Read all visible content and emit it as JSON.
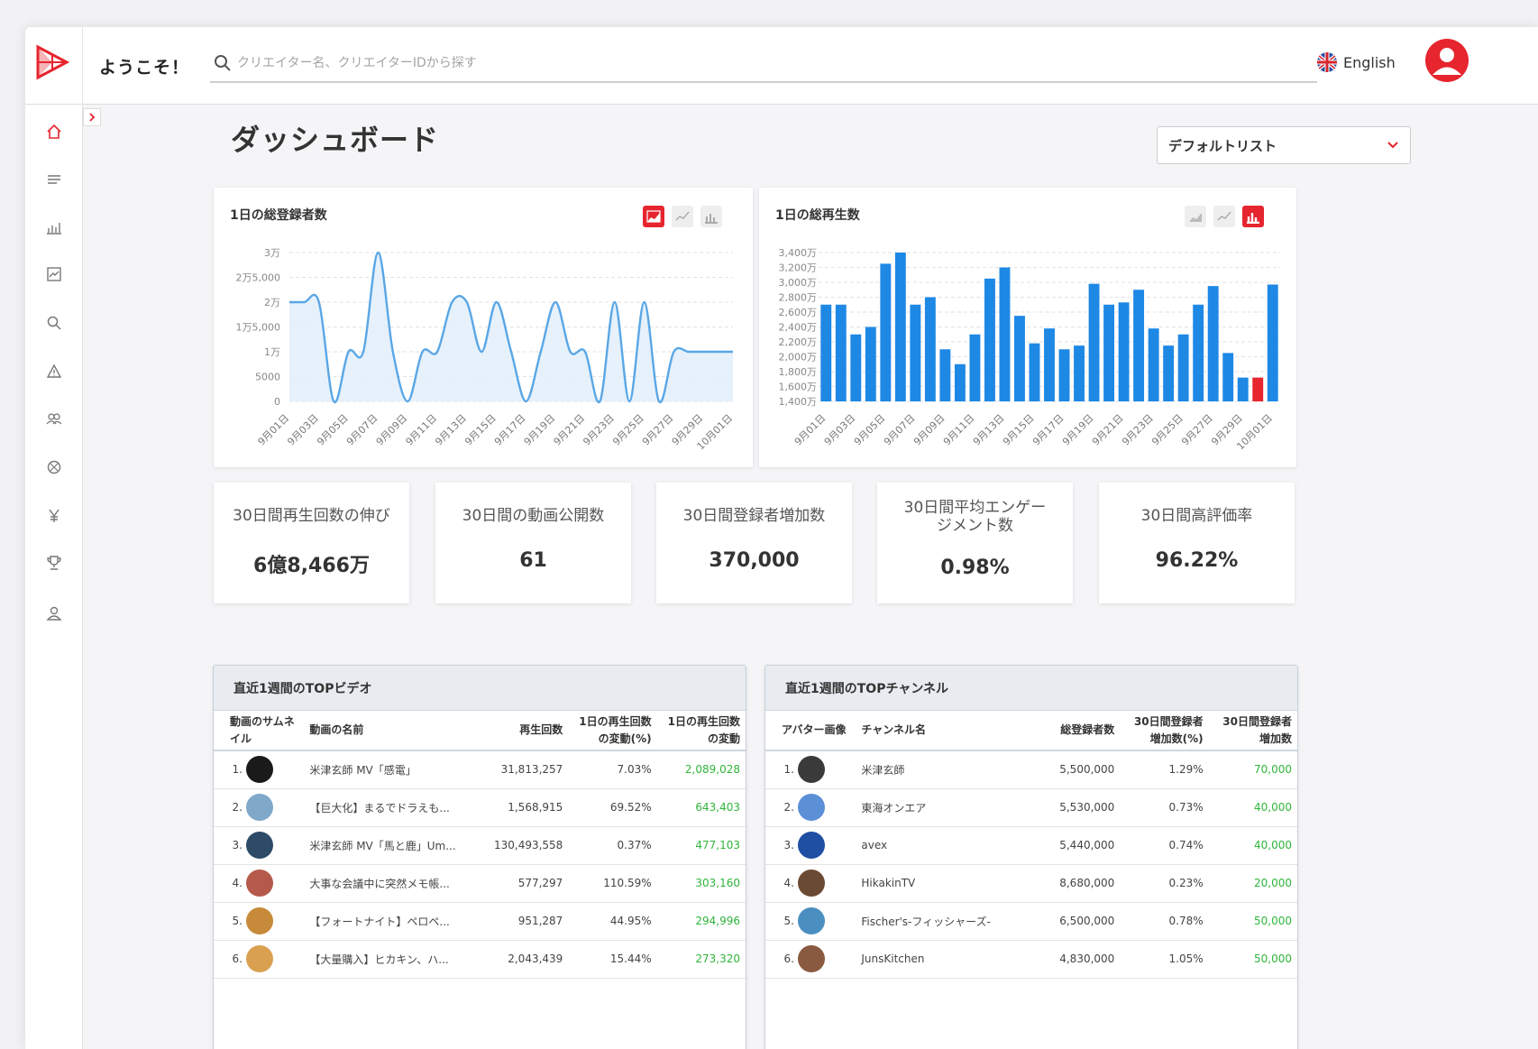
{
  "header": {
    "welcome": "ようこそ！",
    "search_placeholder": "クリエイター名、クリエイターIDから探す",
    "language": "English"
  },
  "sidebar": {
    "items": [
      "home-icon",
      "list-icon",
      "bar-chart-icon",
      "trend-icon",
      "search-icon",
      "warning-icon",
      "group-icon",
      "globe-icon",
      "yen-icon",
      "trophy-icon",
      "user-icon"
    ],
    "active": "home-icon"
  },
  "page": {
    "title": "ダッシュボード",
    "list_select": "デフォルトリスト"
  },
  "colors": {
    "accent": "#e6252e",
    "line": "#5aa7e6",
    "bar": "#1e88e5",
    "green": "#2fb53a"
  },
  "chart_data": [
    {
      "type": "area",
      "title": "1日の総登録者数",
      "yticks": [
        "3万",
        "2万5,000",
        "2万",
        "1万5,000",
        "1万",
        "5000",
        "0"
      ],
      "ylim": [
        0,
        30000
      ],
      "x": [
        "9月01日",
        "9月02日",
        "9月03日",
        "9月04日",
        "9月05日",
        "9月06日",
        "9月07日",
        "9月08日",
        "9月09日",
        "9月10日",
        "9月11日",
        "9月12日",
        "9月13日",
        "9月14日",
        "9月15日",
        "9月16日",
        "9月17日",
        "9月18日",
        "9月19日",
        "9月20日",
        "9月21日",
        "9月22日",
        "9月23日",
        "9月24日",
        "9月25日",
        "9月26日",
        "9月27日",
        "9月28日",
        "9月29日",
        "9月30日",
        "10月01日"
      ],
      "xticks": [
        "9月01日",
        "9月03日",
        "9月05日",
        "9月07日",
        "9月09日",
        "9月11日",
        "9月13日",
        "9月15日",
        "9月17日",
        "9月19日",
        "9月21日",
        "9月23日",
        "9月25日",
        "9月27日",
        "9月29日",
        "10月01日"
      ],
      "values": [
        20000,
        20000,
        20000,
        0,
        10000,
        10000,
        30000,
        10000,
        0,
        10000,
        10000,
        20000,
        20000,
        10000,
        20000,
        10000,
        0,
        10000,
        20000,
        10000,
        10000,
        0,
        20000,
        0,
        20000,
        0,
        10000,
        10000,
        10000,
        10000,
        10000
      ],
      "grid": true
    },
    {
      "type": "bar",
      "title": "1日の総再生数",
      "yticks": [
        "3,400万",
        "3,200万",
        "3,000万",
        "2,800万",
        "2,600万",
        "2,400万",
        "2,200万",
        "2,000万",
        "1,800万",
        "1,600万",
        "1,400万"
      ],
      "ylim": [
        14000000,
        34000000
      ],
      "x": [
        "9月01日",
        "9月02日",
        "9月03日",
        "9月04日",
        "9月05日",
        "9月06日",
        "9月07日",
        "9月08日",
        "9月09日",
        "9月10日",
        "9月11日",
        "9月12日",
        "9月13日",
        "9月14日",
        "9月15日",
        "9月16日",
        "9月17日",
        "9月18日",
        "9月19日",
        "9月20日",
        "9月21日",
        "9月22日",
        "9月23日",
        "9月24日",
        "9月25日",
        "9月26日",
        "9月27日",
        "9月28日",
        "9月29日",
        "9月30日",
        "10月01日"
      ],
      "xticks": [
        "9月01日",
        "9月03日",
        "9月05日",
        "9月07日",
        "9月09日",
        "9月11日",
        "9月13日",
        "9月15日",
        "9月17日",
        "9月19日",
        "9月21日",
        "9月23日",
        "9月25日",
        "9月27日",
        "9月29日",
        "10月01日"
      ],
      "values": [
        27000000,
        27000000,
        23000000,
        24000000,
        32500000,
        34000000,
        27000000,
        28000000,
        21000000,
        19000000,
        23000000,
        30500000,
        32000000,
        25500000,
        21800000,
        23800000,
        21000000,
        21500000,
        29800000,
        27000000,
        27300000,
        29000000,
        23800000,
        21500000,
        23000000,
        27000000,
        29500000,
        20500000,
        17200000,
        17200000,
        29700000
      ],
      "highlight_index": 29,
      "grid": true
    }
  ],
  "stats": [
    {
      "label": "30日間再生回数の伸び",
      "value": "6億8,466万"
    },
    {
      "label": "30日間の動画公開数",
      "value": "61"
    },
    {
      "label": "30日間登録者増加数",
      "value": "370,000"
    },
    {
      "label": "30日間平均エンゲージメント数",
      "value": "0.98%"
    },
    {
      "label": "30日間高評価率",
      "value": "96.22%"
    }
  ],
  "top_videos": {
    "title": "直近1週間のTOPビデオ",
    "headers": [
      "動画のサムネイル",
      "動画の名前",
      "再生回数",
      "1日の再生回数の変動(%)",
      "1日の再生回数の変動"
    ],
    "rows": [
      {
        "rank": "1.",
        "name": "米津玄師 MV「感電」",
        "views": "31,813,257",
        "pct": "7.03%",
        "delta": "2,089,028",
        "thumb": "#1a1a1a"
      },
      {
        "rank": "2.",
        "name": "【巨大化】まるでドラえも...",
        "views": "1,568,915",
        "pct": "69.52%",
        "delta": "643,403",
        "thumb": "#7fa8c9"
      },
      {
        "rank": "3.",
        "name": "米津玄師 MV「馬と鹿」Um...",
        "views": "130,493,558",
        "pct": "0.37%",
        "delta": "477,103",
        "thumb": "#2d4a66"
      },
      {
        "rank": "4.",
        "name": "大事な会議中に突然メモ帳...",
        "views": "577,297",
        "pct": "110.59%",
        "delta": "303,160",
        "thumb": "#b55a4a"
      },
      {
        "rank": "5.",
        "name": "【フォートナイト】ペロペ...",
        "views": "951,287",
        "pct": "44.95%",
        "delta": "294,996",
        "thumb": "#c78a3a"
      },
      {
        "rank": "6.",
        "name": "【大量購入】ヒカキン、ハ...",
        "views": "2,043,439",
        "pct": "15.44%",
        "delta": "273,320",
        "thumb": "#d9a050"
      }
    ]
  },
  "top_channels": {
    "title": "直近1週間のTOPチャンネル",
    "headers": [
      "アバター画像",
      "チャンネル名",
      "総登録者数",
      "30日間登録者増加数(%)",
      "30日間登録者増加数"
    ],
    "rows": [
      {
        "rank": "1.",
        "name": "米津玄師",
        "subs": "5,500,000",
        "pct": "1.29%",
        "delta": "70,000",
        "thumb": "#3a3a3a"
      },
      {
        "rank": "2.",
        "name": "東海オンエア",
        "subs": "5,530,000",
        "pct": "0.73%",
        "delta": "40,000",
        "thumb": "#5b8fd6"
      },
      {
        "rank": "3.",
        "name": "avex",
        "subs": "5,440,000",
        "pct": "0.74%",
        "delta": "40,000",
        "thumb": "#1f4fa3"
      },
      {
        "rank": "4.",
        "name": "HikakinTV",
        "subs": "8,680,000",
        "pct": "0.23%",
        "delta": "20,000",
        "thumb": "#6b4a33"
      },
      {
        "rank": "5.",
        "name": "Fischer's-フィッシャーズ-",
        "subs": "6,500,000",
        "pct": "0.78%",
        "delta": "50,000",
        "thumb": "#4a8fc0"
      },
      {
        "rank": "6.",
        "name": "JunsKitchen",
        "subs": "4,830,000",
        "pct": "1.05%",
        "delta": "50,000",
        "thumb": "#8a5a40"
      }
    ]
  }
}
